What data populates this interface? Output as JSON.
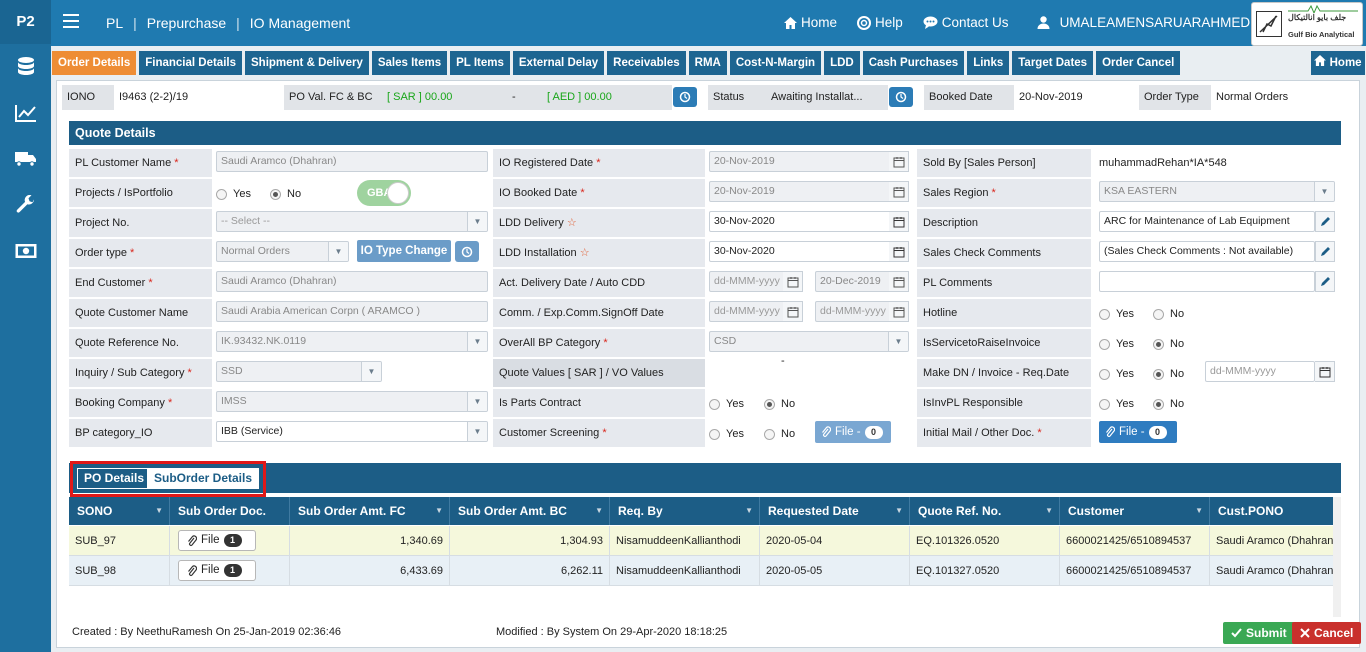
{
  "sidebar": {
    "brand": "P2",
    "icons": [
      "database-icon",
      "chart-line-icon",
      "truck-icon",
      "wrench-icon",
      "money-icon"
    ]
  },
  "header": {
    "crumbs": [
      "PL",
      "Prepurchase",
      "IO Management"
    ],
    "nav": [
      {
        "label": "Home",
        "icon": "home-icon"
      },
      {
        "label": "Help",
        "icon": "lifebuoy-icon"
      },
      {
        "label": "Contact Us",
        "icon": "chat-icon"
      },
      {
        "label": "UMALEAMENSARUARAHMEDI",
        "icon": "user-icon"
      }
    ],
    "logo_text_ar": "جلف بايو انالتيكال",
    "logo_text_en": "Gulf Bio Analytical"
  },
  "tabs": [
    "Order Details",
    "Financial Details",
    "Shipment & Delivery",
    "Sales Items",
    "PL Items",
    "External Delay",
    "Receivables",
    "RMA",
    "Cost-N-Margin",
    "LDD",
    "Cash Purchases",
    "Links",
    "Target Dates",
    "Order Cancel"
  ],
  "home_tab": "Home",
  "info": {
    "iono_label": "IONO",
    "iono_value": "I9463 (2-2)/19",
    "po_label": "PO Val. FC & BC",
    "po_fc": "[ SAR ] 00.00",
    "po_dash": "-",
    "po_bc": "[ AED ] 00.00",
    "status_label": "Status",
    "status_value": "Awaiting Installat...",
    "booked_label": "Booked Date",
    "booked_value": "20-Nov-2019",
    "ordertype_label": "Order Type",
    "ordertype_value": "Normal Orders"
  },
  "quote": {
    "title": "Quote Details",
    "col1": {
      "pl_customer_label": "PL Customer Name",
      "pl_customer_value": "Saudi Aramco (Dhahran)",
      "projects_label": "Projects / IsPortfolio",
      "yes": "Yes",
      "no": "No",
      "gba": "GBA",
      "project_no_label": "Project No.",
      "project_no_value": "-- Select --",
      "order_type_label": "Order type",
      "order_type_value": "Normal Orders",
      "io_type_change": "IO Type Change",
      "end_customer_label": "End Customer",
      "end_customer_value": "Saudi Aramco (Dhahran)",
      "quote_customer_label": "Quote Customer Name",
      "quote_customer_value": "Saudi Arabia American Corpn ( ARAMCO )",
      "quote_ref_label": "Quote Reference No.",
      "quote_ref_value": "IK.93432.NK.0119",
      "inquiry_label": "Inquiry / Sub Category",
      "inquiry_value": "SSD",
      "booking_company_label": "Booking Company",
      "booking_company_value": "IMSS",
      "bp_category_label": "BP category_IO",
      "bp_category_value": "IBB (Service)"
    },
    "col2": {
      "io_registered_label": "IO Registered Date",
      "io_registered_value": "20-Nov-2019",
      "io_booked_label": "IO Booked Date",
      "io_booked_value": "20-Nov-2019",
      "ldd_delivery_label": "LDD Delivery",
      "ldd_delivery_value": "30-Nov-2020",
      "ldd_install_label": "LDD Installation",
      "ldd_install_value": "30-Nov-2020",
      "act_delivery_label": "Act. Delivery Date / Auto CDD",
      "act_delivery_value": "dd-MMM-yyyy",
      "auto_cdd_value": "20-Dec-2019",
      "comm_label": "Comm. / Exp.Comm.SignOff Date",
      "comm_value1": "dd-MMM-yyyy",
      "comm_value2": "dd-MMM-yyyy",
      "overall_bp_label": "OverAll BP Category",
      "overall_bp_value": "CSD",
      "quote_values_label": "Quote Values [ SAR ] / VO Values",
      "quote_values_value": "-",
      "parts_contract_label": "Is Parts Contract",
      "customer_screening_label": "Customer Screening",
      "file_label": "File -",
      "file_count": "0"
    },
    "col3": {
      "sold_by_label": "Sold By [Sales Person]",
      "sold_by_value": "muhammadRehan*IA*548",
      "sales_region_label": "Sales Region",
      "sales_region_value": "KSA EASTERN",
      "description_label": "Description",
      "description_value": "ARC for Maintenance of Lab Equipment",
      "sales_check_label": "Sales Check Comments",
      "sales_check_value": "(Sales Check Comments : Not available)",
      "pl_comments_label": "PL Comments",
      "hotline_label": "Hotline",
      "isservice_label": "IsServicetoRaiseInvoice",
      "make_dn_label": "Make DN / Invoice - Req.Date",
      "make_dn_value": "dd-MMM-yyyy",
      "isinvpl_label": "IsInvPL Responsible",
      "initial_mail_label": "Initial Mail / Other Doc.",
      "file_label": "File -",
      "file_count": "0"
    }
  },
  "subtabs": [
    "PO Details",
    "SubOrder Details"
  ],
  "grid": {
    "columns": [
      "SONO",
      "Sub Order Doc.",
      "Sub Order Amt. FC",
      "Sub Order Amt. BC",
      "Req. By",
      "Requested Date",
      "Quote Ref. No.",
      "Customer",
      "Cust.PONO"
    ],
    "rows": [
      {
        "sono": "SUB_97",
        "doc": "File",
        "doc_count": "1",
        "fc": "1,340.69",
        "bc": "1,304.93",
        "req_by": "NisamuddeenKallianthodi",
        "req_date": "2020-05-04",
        "quote_ref": "EQ.101326.0520",
        "customer": "6600021425/6510894537",
        "pono": "Saudi Aramco (Dhahran)"
      },
      {
        "sono": "SUB_98",
        "doc": "File",
        "doc_count": "1",
        "fc": "6,433.69",
        "bc": "6,262.11",
        "req_by": "NisamuddeenKallianthodi",
        "req_date": "2020-05-05",
        "quote_ref": "EQ.101327.0520",
        "customer": "6600021425/6510894537",
        "pono": "Saudi Aramco (Dhahran)"
      }
    ]
  },
  "footer": {
    "created": "Created : By NeethuRamesh On 25-Jan-2019 02:36:46",
    "modified": "Modified : By System On 29-Apr-2020 18:18:25",
    "submit": "Submit",
    "cancel": "Cancel"
  },
  "colors": {
    "primary": "#1c5d86",
    "accent_tab": "#ee8d35",
    "submit": "#3aa854",
    "cancel": "#c9302c"
  }
}
